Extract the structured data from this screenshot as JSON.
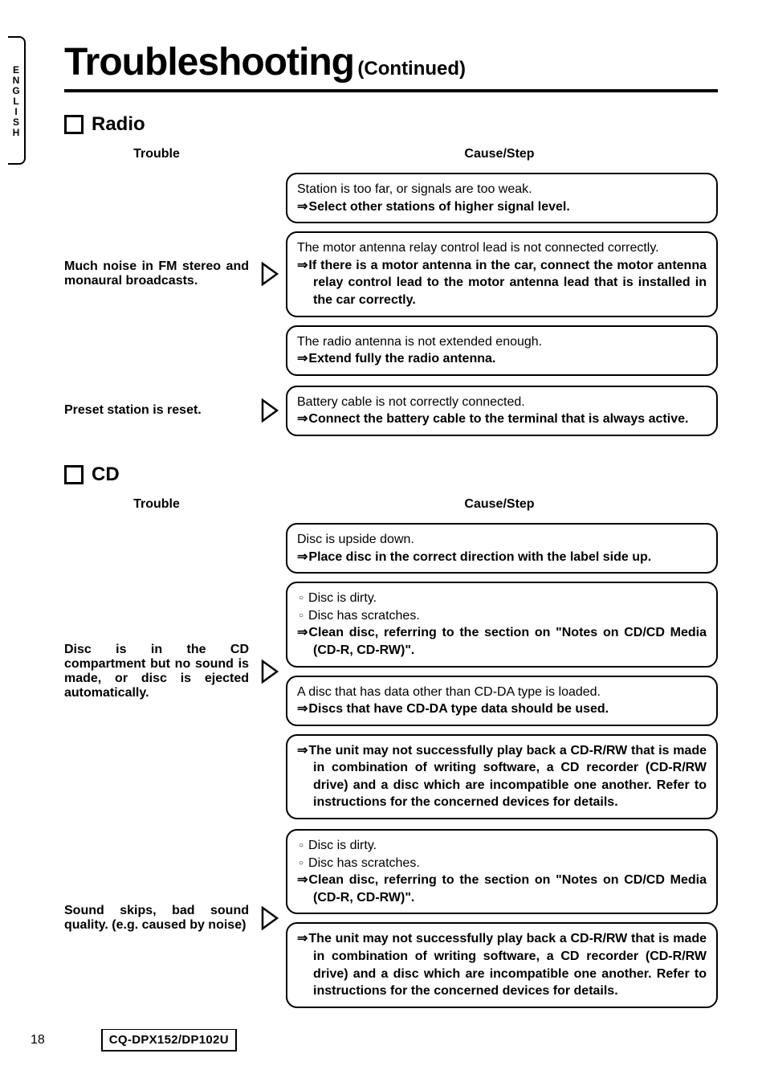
{
  "side_tab": "ENGLISH",
  "title_main": "Troubleshooting",
  "title_sub": "(Continued)",
  "page_number": "18",
  "model": "CQ-DPX152/DP102U",
  "col_trouble": "Trouble",
  "col_cause": "Cause/Step",
  "sections": {
    "radio": {
      "heading": "Radio",
      "rows": [
        {
          "trouble": "Much noise in FM stereo and monaural broadcasts.",
          "boxes": [
            {
              "cause": "Station is too far, or signals are too weak.",
              "step": "Select other stations of higher signal level."
            },
            {
              "cause": "The motor antenna relay control lead is not connected correctly.",
              "step": "If there is a motor antenna in the car, connect the motor antenna relay control lead to the motor antenna lead that is installed in the car correctly."
            },
            {
              "cause": "The radio antenna is not extended enough.",
              "step": "Extend fully the radio antenna."
            }
          ]
        },
        {
          "trouble": "Preset station is reset.",
          "boxes": [
            {
              "cause": "Battery cable is not correctly connected.",
              "step": "Connect the battery cable to the terminal that is always active."
            }
          ]
        }
      ]
    },
    "cd": {
      "heading": "CD",
      "rows": [
        {
          "trouble": "Disc is in the CD compartment but no sound is made, or disc is ejected automatically.",
          "boxes": [
            {
              "cause": "Disc is upside down.",
              "step": "Place disc in the correct direction with the label side up."
            },
            {
              "bullets": [
                "Disc is dirty.",
                "Disc has scratches."
              ],
              "step": "Clean disc, referring to the section on \"Notes on CD/CD Media (CD-R, CD-RW)\"."
            },
            {
              "cause": "A disc that has data other than CD-DA type is loaded.",
              "step": "Discs that have CD-DA type data should be used."
            },
            {
              "step": "The unit may not successfully play back a CD-R/RW that is made in combination of writing software, a CD recorder (CD-R/RW drive) and a disc which are incompatible one another. Refer to instructions for the concerned devices for details."
            }
          ]
        },
        {
          "trouble": "Sound skips, bad sound quality. (e.g. caused by noise)",
          "boxes": [
            {
              "bullets": [
                "Disc is dirty.",
                "Disc has scratches."
              ],
              "step": "Clean disc, referring to the section on \"Notes on CD/CD Media (CD-R, CD-RW)\"."
            },
            {
              "step": "The unit may not successfully play back a CD-R/RW that is made in combination of writing software, a CD recorder (CD-R/RW drive) and a disc which are incompatible one another. Refer to instructions for the concerned devices for details."
            }
          ]
        }
      ]
    }
  }
}
